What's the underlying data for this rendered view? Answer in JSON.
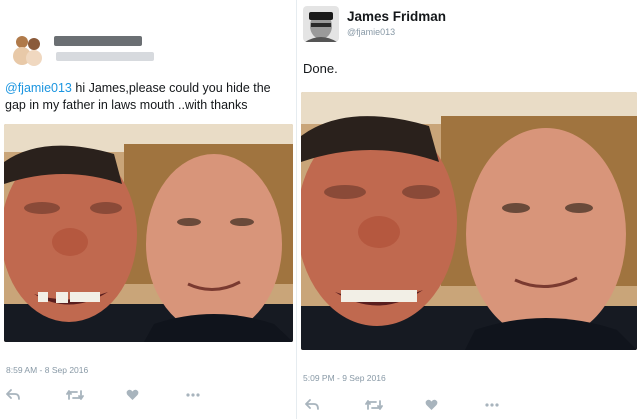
{
  "left_tweet": {
    "mention": "@fjamie013",
    "text": " hi James,please could you hide the gap in my father in laws mouth ..with thanks",
    "timestamp": "8:59 AM - 8 Sep 2016"
  },
  "right_tweet": {
    "author_name": "James Fridman",
    "author_handle": "@fjamie013",
    "text": "Done.",
    "timestamp": "5:09 PM - 9 Sep 2016"
  },
  "colors": {
    "mention": "#1b95e0",
    "meta": "#8899a6",
    "icon": "#a8b4bd"
  },
  "icons": [
    "reply-icon",
    "retweet-icon",
    "like-icon",
    "more-icon"
  ]
}
